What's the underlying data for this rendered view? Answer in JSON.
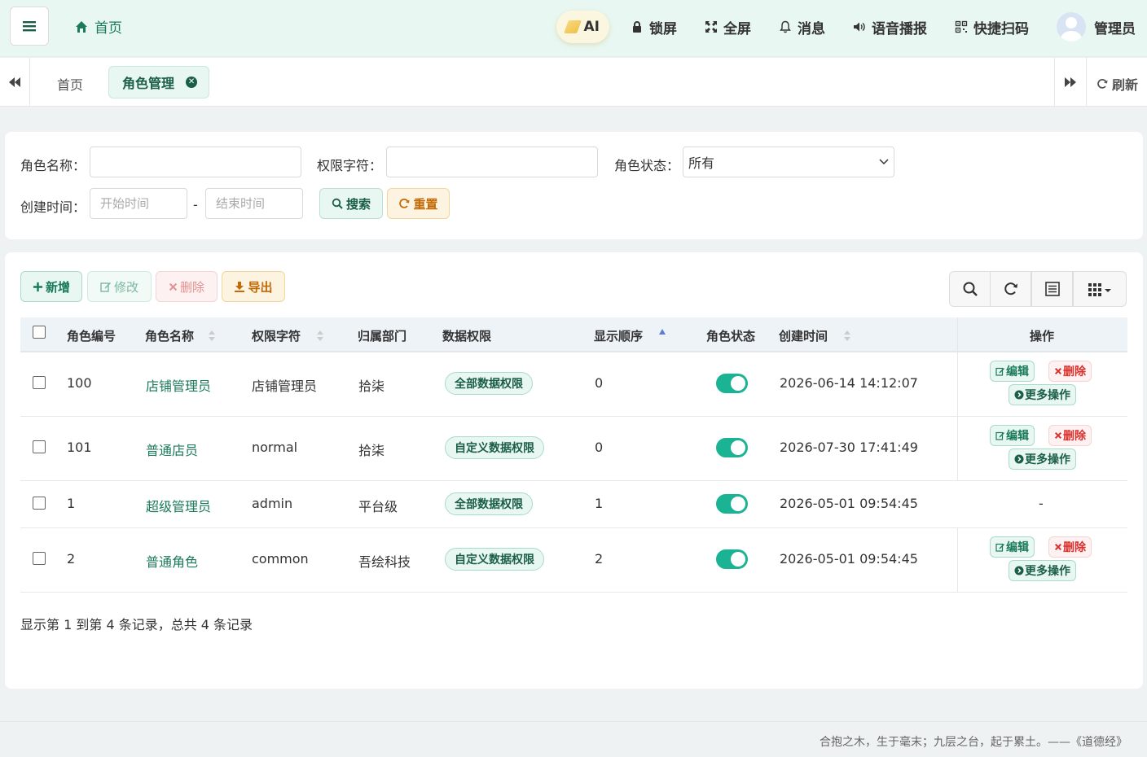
{
  "navbar": {
    "home_label": "首页",
    "ai_label": "AI",
    "items": [
      {
        "label": "锁屏",
        "icon": "lock-icon"
      },
      {
        "label": "全屏",
        "icon": "fullscreen-icon"
      },
      {
        "label": "消息",
        "icon": "bell-icon"
      },
      {
        "label": "语音播报",
        "icon": "speaker-icon"
      },
      {
        "label": "快捷扫码",
        "icon": "qrcode-icon"
      }
    ],
    "user_label": "管理员"
  },
  "tabs": {
    "home_label": "首页",
    "active_label": "角色管理",
    "refresh_label": "刷新"
  },
  "search": {
    "role_name_label": "角色名称：",
    "role_key_label": "权限字符：",
    "status_label": "角色状态：",
    "status_selected": "所有",
    "created_label": "创建时间：",
    "start_placeholder": "开始时间",
    "end_placeholder": "结束时间",
    "range_separator": "-",
    "search_button": "搜索",
    "reset_button": "重置"
  },
  "toolbar": {
    "add_label": "新增",
    "edit_label": "修改",
    "delete_label": "删除",
    "export_label": "导出"
  },
  "table": {
    "columns": [
      "角色编号",
      "角色名称",
      "权限字符",
      "归属部门",
      "数据权限",
      "显示顺序",
      "角色状态",
      "创建时间",
      "操作"
    ],
    "rows": [
      {
        "id": "100",
        "name": "店铺管理员",
        "key": "店铺管理员",
        "dept": "拾柒",
        "scope": "全部数据权限",
        "order": "0",
        "enabled": true,
        "created": "2026-06-14 14:12:07",
        "has_actions": true
      },
      {
        "id": "101",
        "name": "普通店员",
        "key": "normal",
        "dept": "拾柒",
        "scope": "自定义数据权限",
        "order": "0",
        "enabled": true,
        "created": "2026-07-30 17:41:49",
        "has_actions": true
      },
      {
        "id": "1",
        "name": "超级管理员",
        "key": "admin",
        "dept": "平台级",
        "scope": "全部数据权限",
        "order": "1",
        "enabled": true,
        "created": "2026-05-01 09:54:45",
        "has_actions": false,
        "action_placeholder": "-"
      },
      {
        "id": "2",
        "name": "普通角色",
        "key": "common",
        "dept": "吾绘科技",
        "scope": "自定义数据权限",
        "order": "2",
        "enabled": true,
        "created": "2026-05-01 09:54:45",
        "has_actions": true
      }
    ],
    "action_labels": {
      "edit": "编辑",
      "delete": "删除",
      "more": "更多操作"
    },
    "pager_text": "显示第 1 到第 4 条记录，总共 4 条记录"
  },
  "footer": {
    "quote": "合抱之木，生于毫末；九层之台，起于累土。——《道德经》"
  },
  "colors": {
    "accent": "#1ab394",
    "primary_text": "#1a7a5a",
    "navbar_bg": "#e8f7f1",
    "danger": "#d9302c",
    "warning": "#c26a06"
  }
}
